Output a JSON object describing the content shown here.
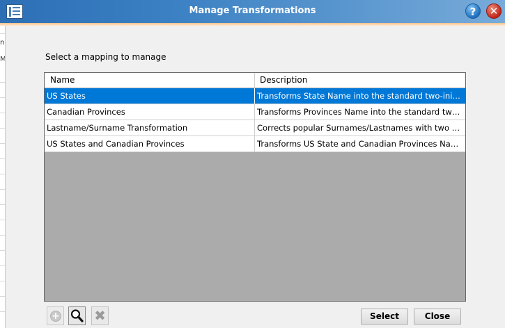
{
  "window": {
    "title": "Manage Transformations",
    "help_glyph": "?",
    "close_glyph": "✕",
    "icons": [
      "app-list-icon",
      "help-icon",
      "close-icon"
    ]
  },
  "background_fragments": [
    "ne",
    "M"
  ],
  "instruction": "Select a mapping to manage",
  "grid": {
    "columns": [
      "Name",
      "Description"
    ],
    "rows": [
      {
        "name": "US States",
        "description": "Transforms State Name into the standard two-initial format.",
        "selected": true
      },
      {
        "name": "Canadian Provinces",
        "description": "Transforms Provinces Name into the standard two-initial format",
        "selected": false
      },
      {
        "name": "Lastname/Surname Transformation",
        "description": "Corrects popular Surnames/Lastnames with two upper-case letters",
        "selected": false
      },
      {
        "name": "US States and Canadian Provinces",
        "description": "Transforms US State and Canadian Provinces Names into standard",
        "selected": false
      }
    ],
    "selection_color": "#0078d7"
  },
  "toolbar": {
    "add_glyph": "+",
    "delete_glyph": "✖",
    "icons": [
      "add-icon",
      "search-icon",
      "delete-icon"
    ]
  },
  "buttons": {
    "select_label": "Select",
    "close_label": "Close"
  }
}
